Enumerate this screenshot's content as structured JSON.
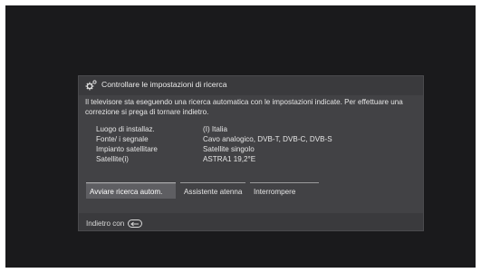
{
  "dialog": {
    "title": "Controllare le impostazioni di ricerca",
    "icon": "gear-icon",
    "description": "Il televisore sta eseguendo una ricerca automatica con le impostazioni indicate. Per effettuare una correzione si prega di tornare indietro.",
    "settings": [
      {
        "label": "Luogo di installaz.",
        "value": "(I) Italia"
      },
      {
        "label": "Fonte/ i segnale",
        "value": "Cavo analogico, DVB-T, DVB-C, DVB-S"
      },
      {
        "label": "Impianto satellitare",
        "value": "Satellite singolo"
      },
      {
        "label": "Satellite(i)",
        "value": "ASTRA1 19,2°E"
      }
    ],
    "buttons": {
      "start": "Avviare ricerca autom.",
      "assistant": "Assistente atenna",
      "stop": "Interrompere"
    },
    "footer": {
      "back_text": "Indietro con",
      "back_icon": "back-button-icon"
    }
  },
  "colors": {
    "screen_bg": "#1a1a1c",
    "dialog_bg": "#3a3a3d",
    "body_bg": "#424245",
    "focused_button": "#5e5e62",
    "text": "#e6e6e6"
  }
}
